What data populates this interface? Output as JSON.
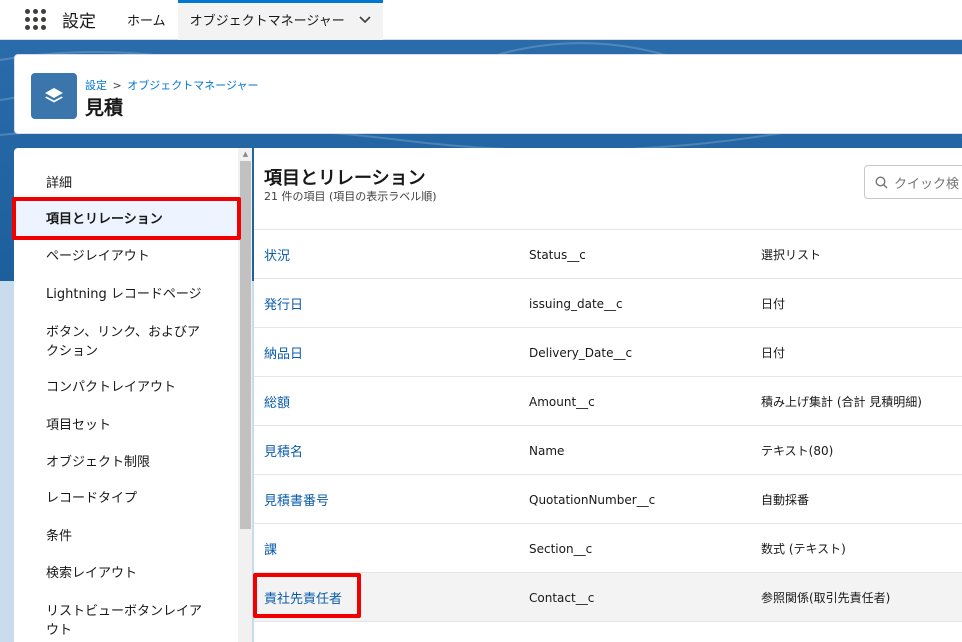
{
  "topbar": {
    "app_name": "設定",
    "tabs": [
      {
        "label": "ホーム"
      },
      {
        "label": "オブジェクトマネージャー"
      }
    ]
  },
  "header": {
    "breadcrumb": [
      "設定",
      "オブジェクトマネージャー"
    ],
    "breadcrumb_sep": ">",
    "title": "見積"
  },
  "sidebar": {
    "items": [
      {
        "label": "詳細"
      },
      {
        "label": "項目とリレーション"
      },
      {
        "label": "ページレイアウト"
      },
      {
        "label": "Lightning レコードページ"
      },
      {
        "label": "ボタン、リンク、およびア"
      },
      {
        "label": "クション"
      },
      {
        "label": "コンパクトレイアウト"
      },
      {
        "label": "項目セット"
      },
      {
        "label": "オブジェクト制限"
      },
      {
        "label": "レコードタイプ"
      },
      {
        "label": "条件"
      },
      {
        "label": "検索レイアウト"
      },
      {
        "label": "リストビューボタンレイア"
      },
      {
        "label": "ウト"
      }
    ]
  },
  "main": {
    "title": "項目とリレーション",
    "subtitle": "21 件の項目 (項目の表示ラベル順)",
    "search_placeholder": "クイック検",
    "rows": [
      {
        "label": "状況",
        "api": "Status__c",
        "type": "選択リスト"
      },
      {
        "label": "発行日",
        "api": "issuing_date__c",
        "type": "日付"
      },
      {
        "label": "納品日",
        "api": "Delivery_Date__c",
        "type": "日付"
      },
      {
        "label": "総額",
        "api": "Amount__c",
        "type": "積み上げ集計 (合計 見積明細)"
      },
      {
        "label": "見積名",
        "api": "Name",
        "type": "テキスト(80)"
      },
      {
        "label": "見積書番号",
        "api": "QuotationNumber__c",
        "type": "自動採番"
      },
      {
        "label": "課",
        "api": "Section__c",
        "type": "数式 (テキスト)"
      },
      {
        "label": "責社先責任者",
        "api": "Contact__c",
        "type": "参照関係(取引先責任者)"
      }
    ]
  },
  "colors": {
    "brand_blue": "#0176d3",
    "link_blue": "#0b5cab",
    "annotation_red": "#f00000"
  }
}
